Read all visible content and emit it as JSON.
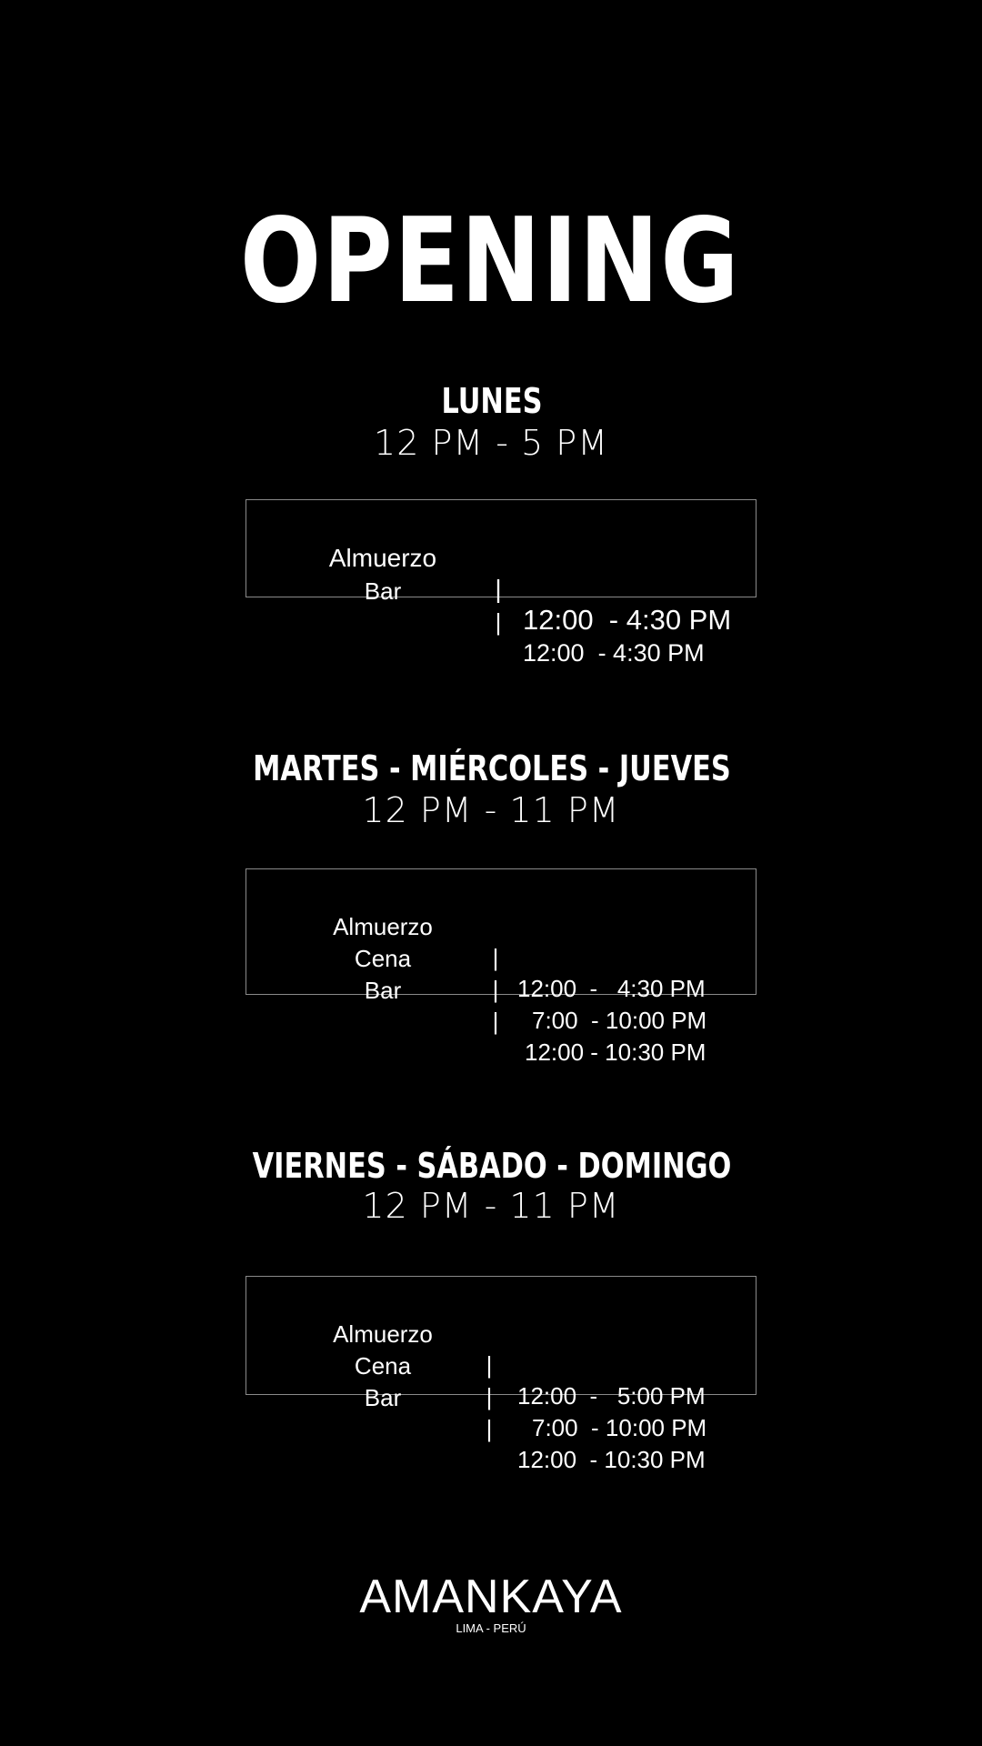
{
  "title": "OPENING",
  "sections": [
    {
      "days": "LUNES",
      "hours": "12 PM - 5 PM",
      "services": [
        {
          "name": "Almuerzo",
          "separator": "|",
          "time": "12:00  - 4:30 PM"
        },
        {
          "name": "Bar",
          "separator": "|",
          "time": "12:00  - 4:30 PM"
        }
      ]
    },
    {
      "days": "MARTES - MIÉRCOLES - JUEVES",
      "hours": "12 PM - 11 PM",
      "services": [
        {
          "name": "Almuerzo",
          "separator": "|",
          "time": "12:00  -   4:30 PM"
        },
        {
          "name": "Cena",
          "separator": "|",
          "time": "7:00  - 10:00 PM"
        },
        {
          "name": "Bar",
          "separator": "|",
          "time": "12:00 - 10:30 PM"
        }
      ]
    },
    {
      "days": "VIERNES - SÁBADO - DOMINGO",
      "hours": "12 PM -  11 PM",
      "services": [
        {
          "name": "Almuerzo",
          "separator": "|",
          "time": "12:00  -   5:00 PM"
        },
        {
          "name": "Cena",
          "separator": "|",
          "time": "7:00  - 10:00 PM"
        },
        {
          "name": "Bar",
          "separator": "|",
          "time": "12:00  - 10:30 PM"
        }
      ]
    }
  ],
  "brand": {
    "name": "AMANKAYA",
    "location": "LIMA - PERÚ"
  },
  "colors": {
    "background": "#000000",
    "text": "#ffffff",
    "border": "#8a8a8a"
  }
}
